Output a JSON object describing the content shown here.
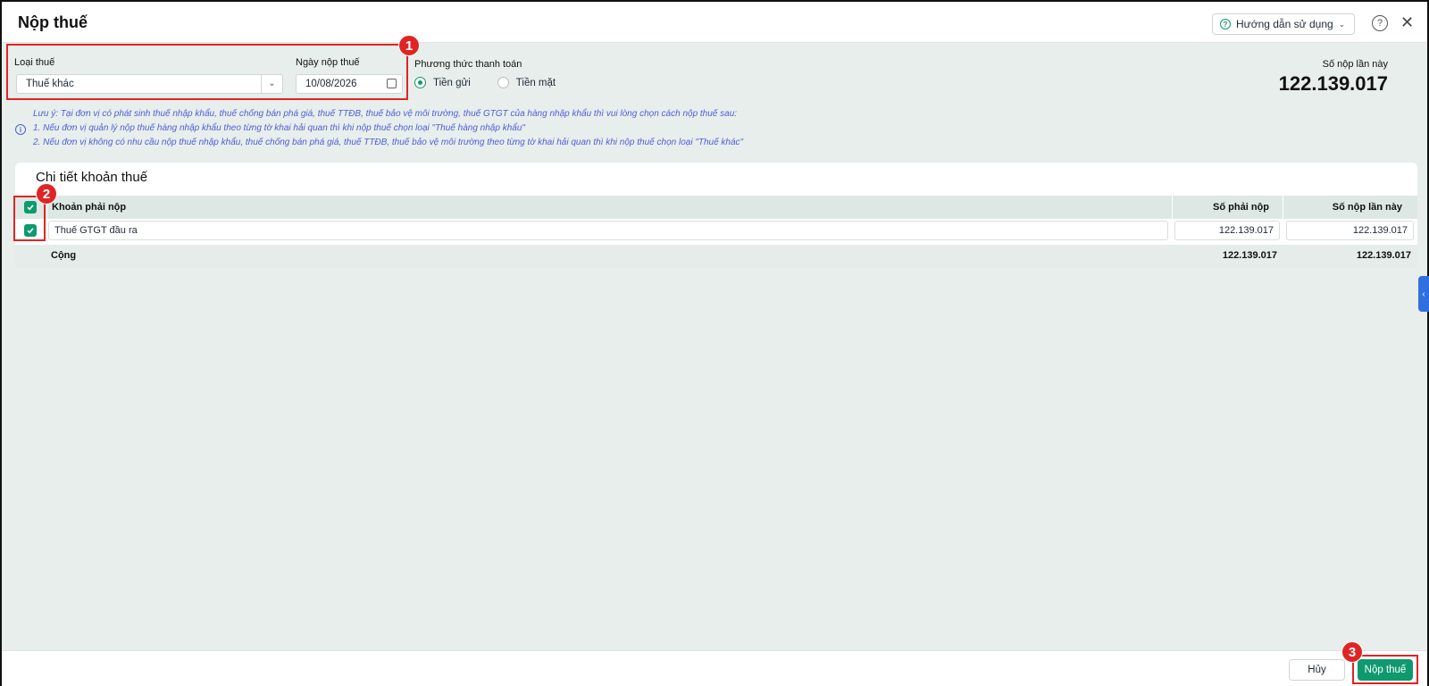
{
  "header": {
    "title": "Nộp thuế",
    "guide_label": "Hướng dẫn sử dụng",
    "help_symbol": "?",
    "close_symbol": "✕"
  },
  "form": {
    "tax_type_label": "Loại thuế",
    "tax_type_value": "Thuế khác",
    "date_label": "Ngày nộp thuế",
    "date_value": "10/08/2026",
    "payment_method_label": "Phương thức thanh toán",
    "payment_options": [
      {
        "label": "Tiền gửi",
        "selected": true
      },
      {
        "label": "Tiền mặt",
        "selected": false
      }
    ],
    "amount_label": "Số nộp lần này",
    "amount_value": "122.139.017"
  },
  "notes": [
    "Lưu ý: Tại đơn vị có phát sinh thuế nhập khẩu, thuế chống bán phá giá, thuế TTĐB, thuế bảo vệ môi trường, thuế GTGT của hàng nhập khẩu thì vui lòng chọn cách nộp thuế sau:",
    "1. Nếu đơn vị quản lý nộp thuế hàng nhập khẩu theo từng tờ khai hải quan thì khi nộp thuế chọn loại \"Thuế hàng nhập khẩu\"",
    "2. Nếu đơn vị không có nhu cầu nộp thuế nhập khẩu, thuế chống bán phá giá, thuế TTĐB, thuế bảo vệ môi trường theo từng tờ khai hải quan thì khi nộp thuế chọn loại \"Thuế khác\""
  ],
  "detail": {
    "title": "Chi tiết khoản thuế",
    "columns": [
      "Khoản phải nộp",
      "Số phải nộp",
      "Số nộp lần này"
    ],
    "rows": [
      {
        "name": "Thuế GTGT đầu ra",
        "due": "122.139.017",
        "pay": "122.139.017",
        "checked": true
      }
    ],
    "total": {
      "label": "Cộng",
      "due": "122.139.017",
      "pay": "122.139.017"
    }
  },
  "footer": {
    "cancel_label": "Hủy",
    "submit_label": "Nộp thuế"
  },
  "annotations": [
    "1",
    "2",
    "3"
  ],
  "colors": {
    "accent": "#0d9a6e",
    "highlight": "#e02424",
    "note": "#4b5fd8"
  }
}
